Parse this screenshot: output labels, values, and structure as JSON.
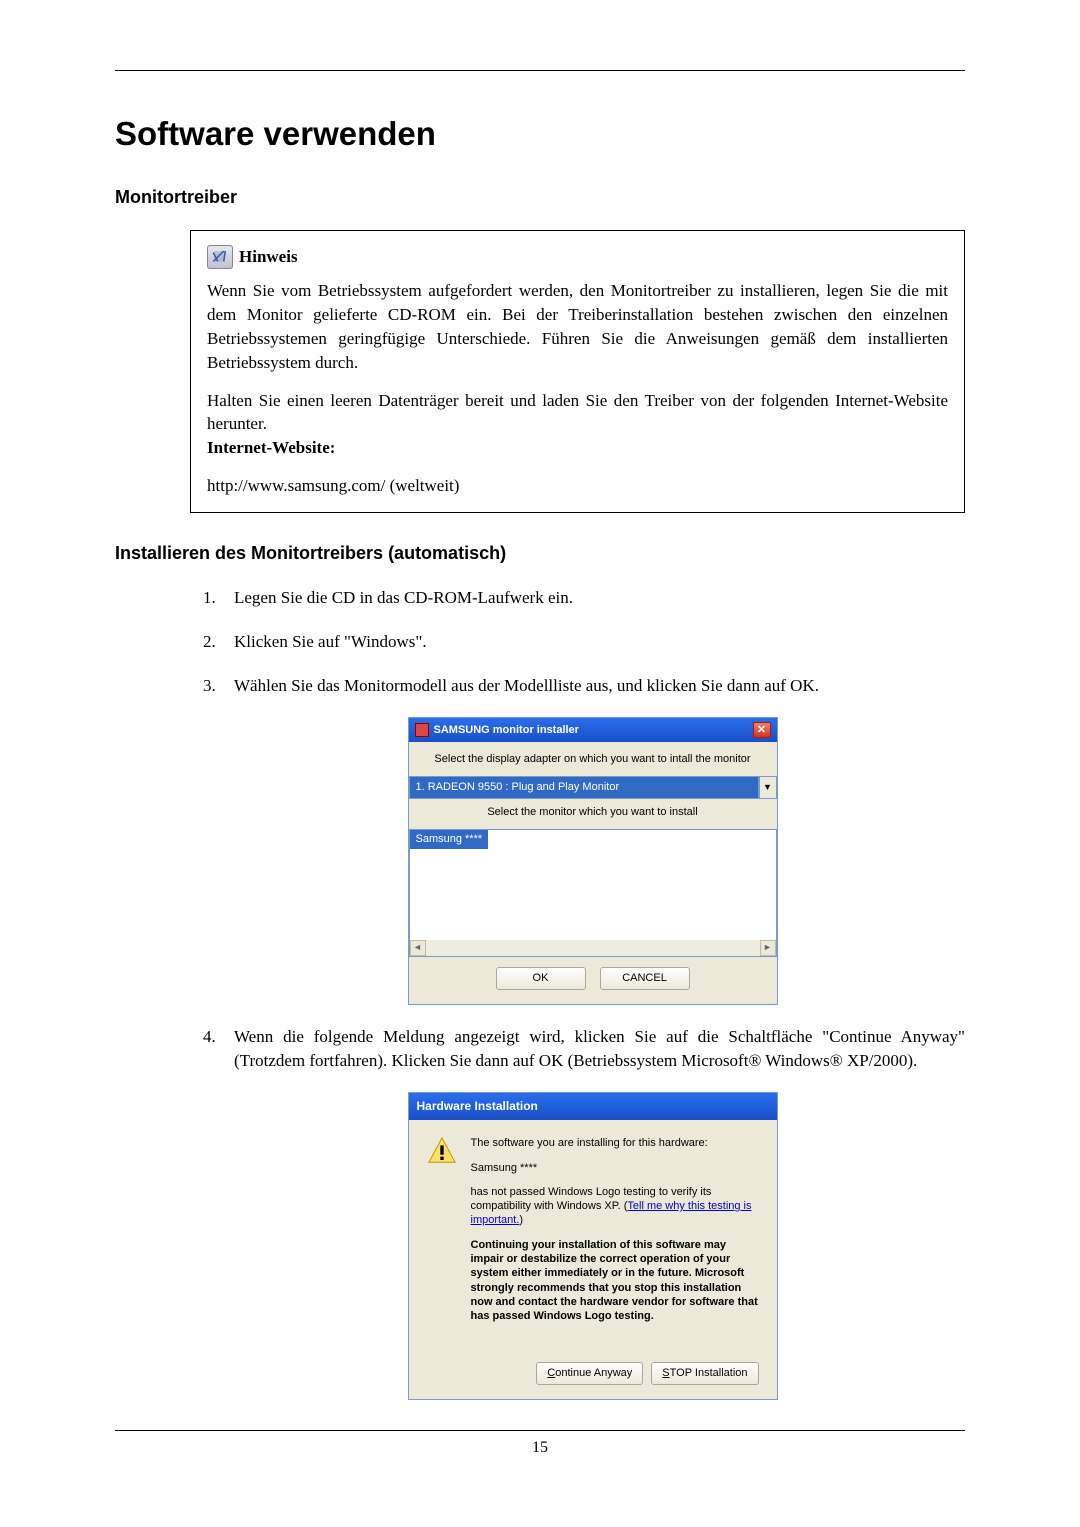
{
  "title": "Software verwenden",
  "section1": "Monitortreiber",
  "note": {
    "title": "Hinweis",
    "p1": "Wenn Sie vom Betriebssystem aufgefordert werden, den Monitortreiber zu installieren, legen Sie die mit dem Monitor gelieferte CD-ROM ein. Bei der Treiberinstallation bestehen zwischen den einzelnen Betriebssystemen geringfügige Unterschiede. Führen Sie die Anweisungen gemäß dem installierten Betriebssystem durch.",
    "p2": "Halten Sie einen leeren Datenträger bereit und laden Sie den Treiber von der folgenden Internet-Website herunter.",
    "label_internet": "Internet-Website:",
    "url": "http://www.samsung.com/ (weltweit)"
  },
  "section2": "Installieren des Monitortreibers (automatisch)",
  "steps": {
    "s1": "Legen Sie die CD in das CD-ROM-Laufwerk ein.",
    "s2": "Klicken Sie auf \"Windows\".",
    "s3": "Wählen Sie das Monitormodell aus der Modellliste aus, und klicken Sie dann auf OK.",
    "s4": "Wenn die folgende Meldung angezeigt wird, klicken Sie auf die Schaltfläche \"Continue Anyway\" (Trotzdem fortfahren). Klicken Sie dann auf OK (Betriebssystem Microsoft® Windows® XP/2000)."
  },
  "dialog1": {
    "title": "SAMSUNG monitor installer",
    "label1": "Select the display adapter on which you want to intall the monitor",
    "dropdown": "1. RADEON 9550 : Plug and Play Monitor",
    "label2": "Select the monitor which you want to install",
    "item": "Samsung ****",
    "ok": "OK",
    "cancel": "CANCEL"
  },
  "dialog2": {
    "title": "Hardware Installation",
    "p1": "The software you are installing for this hardware:",
    "p2": "Samsung ****",
    "p3a": "has not passed Windows Logo testing to verify its compatibility with Windows XP. (",
    "p3link": "Tell me why this testing is important.",
    "p3b": ")",
    "p4": "Continuing your installation of this software may impair or destabilize the correct operation of your system either immediately or in the future. Microsoft strongly recommends that you stop this installation now and contact the hardware vendor for software that has passed Windows Logo testing.",
    "btn_continue": "Continue Anyway",
    "btn_stop": "STOP Installation"
  },
  "page_number": "15"
}
